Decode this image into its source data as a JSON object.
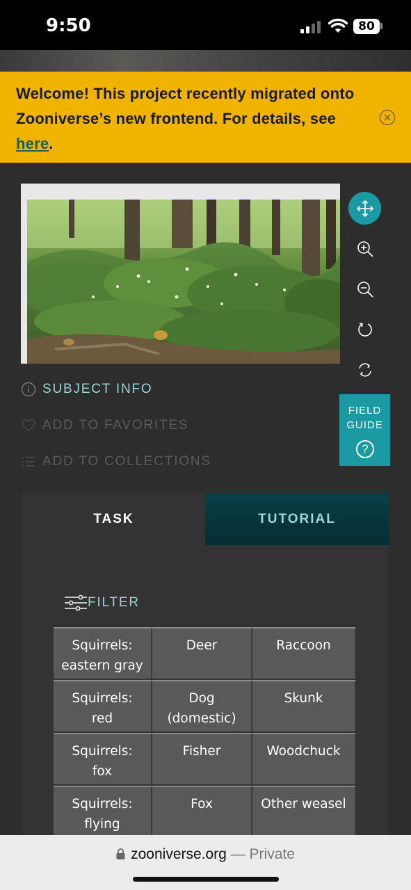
{
  "status_bar": {
    "time": "9:50",
    "battery": "80"
  },
  "banner": {
    "text_before": "Welcome! This project recently migrated onto Zooniverse’s new frontend. For details, see ",
    "link_text": "here",
    "text_after": ".",
    "bg_color": "#f0b400"
  },
  "toolbar": {
    "tools": [
      "move-icon",
      "zoom-in-icon",
      "zoom-out-icon",
      "rotate-icon",
      "reset-icon"
    ],
    "active_color": "#1c9aa3"
  },
  "field_guide": {
    "label": "FIELD\nGUIDE",
    "icon": "?"
  },
  "meta_actions": {
    "subject_info": "SUBJECT INFO",
    "add_to_favorites": "ADD TO FAVORITES",
    "add_to_collections": "ADD TO COLLECTIONS"
  },
  "task_panel": {
    "tabs": {
      "task": "TASK",
      "tutorial": "TUTORIAL"
    },
    "filter_label": "FILTER",
    "choices": [
      [
        "Squirrels:\neastern gray",
        "Deer",
        "Raccoon"
      ],
      [
        "Squirrels:\nred",
        "Dog\n(domestic)",
        "Skunk"
      ],
      [
        "Squirrels:\nfox",
        "Fisher",
        "Woodchuck"
      ],
      [
        "Squirrels:\nflying",
        "Fox",
        "Other weasel"
      ]
    ]
  },
  "browser": {
    "domain": "zooniverse.org",
    "suffix": " — Private"
  }
}
